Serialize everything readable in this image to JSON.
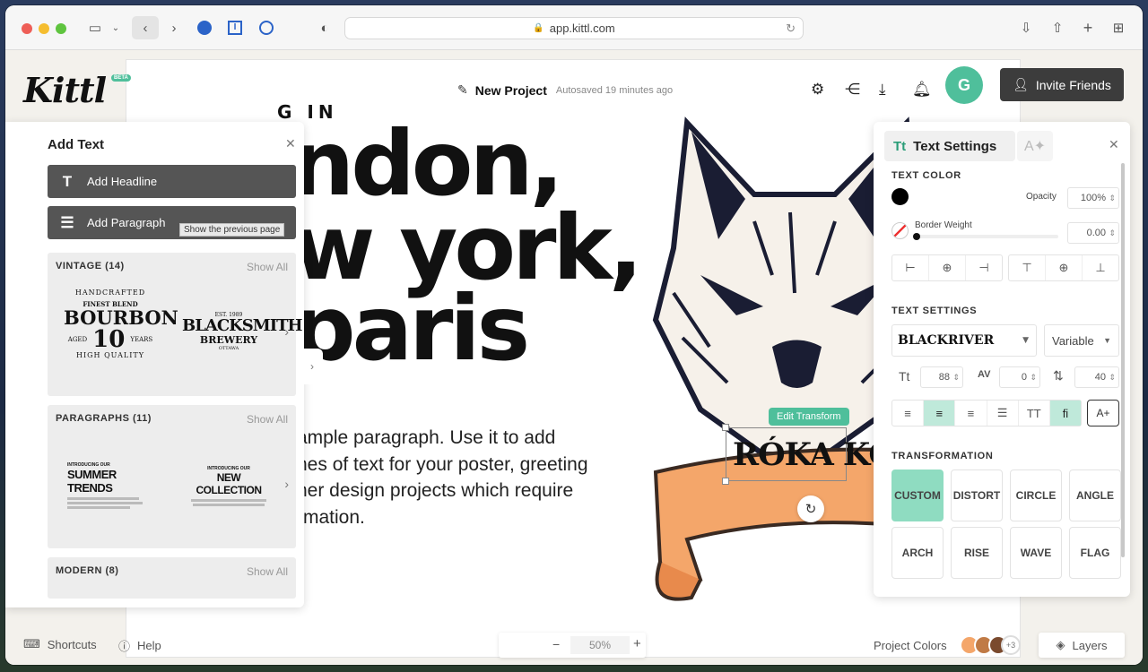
{
  "browser": {
    "url": "app.kittl.com"
  },
  "header": {
    "logo": "Kittl",
    "beta": "BETA",
    "project_name": "New Project",
    "autosave": "Autosaved 19 minutes ago",
    "avatar_initial": "G",
    "invite_label": "Invite Friends"
  },
  "add_text": {
    "title": "Add Text",
    "headline_label": "Add Headline",
    "paragraph_label": "Add Paragraph",
    "tooltip": "Show the previous page",
    "categories": [
      {
        "title": "VINTAGE (14)",
        "show_all": "Show All"
      },
      {
        "title": "PARAGRAPHS (11)",
        "show_all": "Show All"
      },
      {
        "title": "MODERN (8)",
        "show_all": "Show All"
      }
    ],
    "vintage_samples": {
      "bourbon": {
        "top": "HANDCRAFTED",
        "blend": "FINEST BLEND",
        "main": "BOURBON",
        "aged": "AGED",
        "num": "10",
        "years": "YEARS",
        "bottom": "HIGH QUALITY"
      },
      "blacksmith": {
        "est": "EST. 1989",
        "main": "BLACKSMITH",
        "sub": "BREWERY",
        "city": "OTTAWA"
      }
    },
    "paragraph_samples": [
      {
        "intro": "INTRODUCING OUR",
        "title": "SUMMER TRENDS"
      },
      {
        "intro": "INTRODUCING OUR",
        "title": "NEW COLLECTION"
      }
    ]
  },
  "artboard": {
    "sign": "G IN",
    "line1": "ndon,",
    "line2": "w york,",
    "line3": "paris",
    "paragraph": "ample paragraph. Use it to add\nnes of text for your poster, greeting\nher design projects which require\nrmation.",
    "banner_text": "RÓKA KOMA",
    "edit_transform": "Edit Transform"
  },
  "text_settings": {
    "tab_label": "Text Settings",
    "text_color_title": "TEXT COLOR",
    "opacity_label": "Opacity",
    "opacity_value": "100%",
    "border_weight_label": "Border Weight",
    "border_weight_value": "0.00",
    "settings_title": "TEXT SETTINGS",
    "font_name": "BLACKRIVER",
    "font_style": "Variable",
    "size_value": "88",
    "spacing_value": "0",
    "line_height_value": "40",
    "transformation_title": "TRANSFORMATION",
    "transforms": [
      "CUSTOM",
      "DISTORT",
      "CIRCLE",
      "ANGLE",
      "ARCH",
      "RISE",
      "WAVE",
      "FLAG"
    ]
  },
  "footer": {
    "shortcuts": "Shortcuts",
    "help": "Help",
    "zoom": "50%",
    "project_colors": "Project Colors",
    "more_colors": "+3",
    "layers": "Layers"
  },
  "colors": {
    "accent": "#4fbf9b",
    "accent_light": "#8fdcc1",
    "banner": "#f4a66a",
    "dark_button": "#3c3c3c"
  }
}
